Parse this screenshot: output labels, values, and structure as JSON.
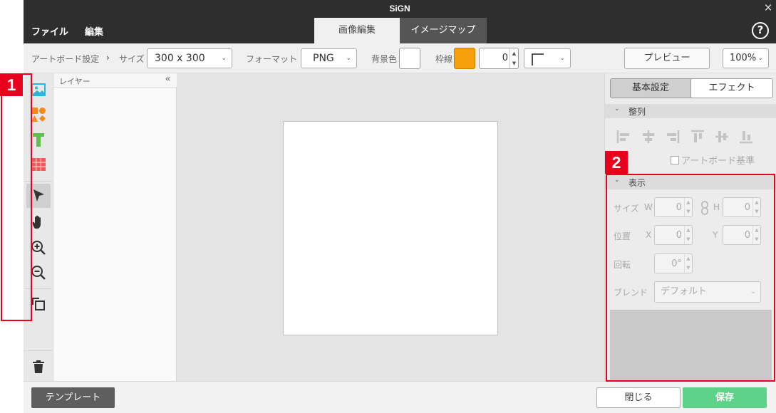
{
  "app": {
    "title": "SiGN"
  },
  "menu": {
    "file": "ファイル",
    "edit": "編集"
  },
  "tabs": {
    "image_edit": "画像編集",
    "image_map": "イメージマップ"
  },
  "toolbar": {
    "breadcrumb_root": "アートボード設定",
    "breadcrumb_sep": "›",
    "size_label": "サイズ",
    "size_value": "300 x 300",
    "format_label": "フォーマット",
    "format_value": "PNG",
    "bg_label": "背景色",
    "bg_color": "#ffffff",
    "border_label": "枠線",
    "border_color": "#f7a00c",
    "border_width": "0",
    "preview": "プレビュー",
    "zoom": "100%"
  },
  "tools": [
    "image-tool",
    "shapes-tool",
    "text-tool",
    "table-tool",
    "select-tool",
    "hand-tool",
    "zoom-in-tool",
    "zoom-out-tool",
    "arrange-tool"
  ],
  "layers": {
    "title": "レイヤー",
    "collapse": "«"
  },
  "props": {
    "tab_basic": "基本設定",
    "tab_effect": "エフェクト",
    "align_section": "整列",
    "artboard_ref": "アートボード基準",
    "display_section": "表示",
    "size_label": "サイズ",
    "w_label": "W",
    "w_value": "0",
    "h_label": "H",
    "h_value": "0",
    "position_label": "位置",
    "x_label": "X",
    "x_value": "0",
    "y_label": "Y",
    "y_value": "0",
    "rotate_label": "回転",
    "rotate_value": "0°",
    "blend_label": "ブレンド",
    "blend_value": "デフォルト"
  },
  "annotations": {
    "badge1": "1",
    "badge2": "2"
  },
  "footer": {
    "template": "テンプレート",
    "close": "閉じる",
    "save": "保存"
  },
  "colors": {
    "accent_red": "#e8001d",
    "save_green": "#5fd28a",
    "dark": "#2e2e2e"
  }
}
